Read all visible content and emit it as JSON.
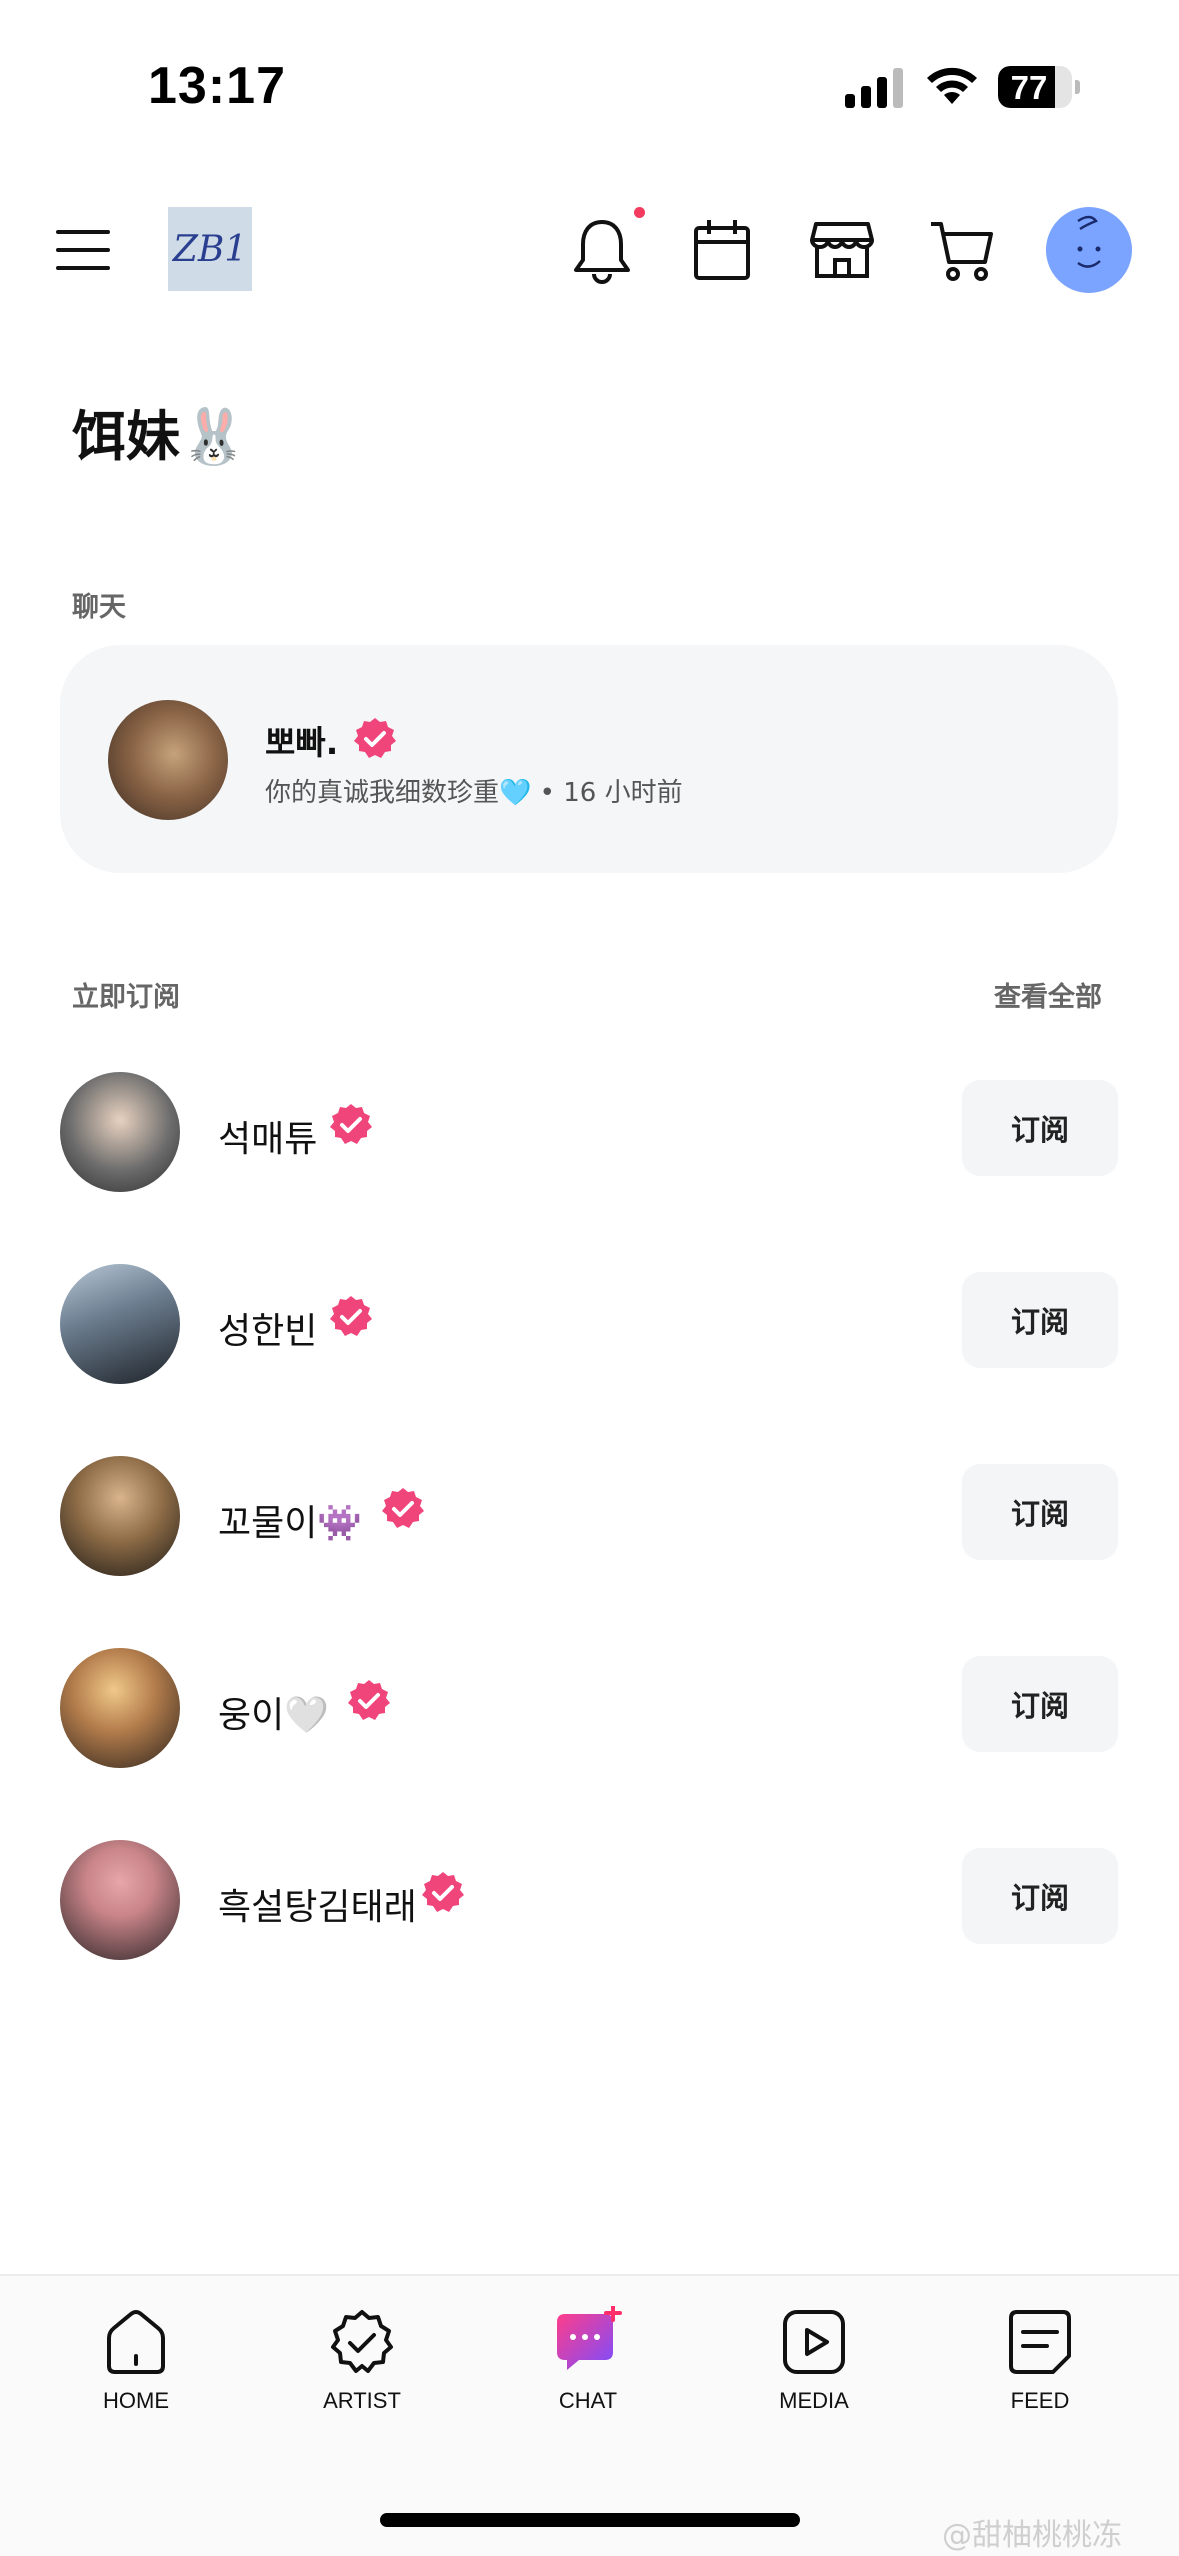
{
  "status_bar": {
    "time": "13:17",
    "battery": "77",
    "battery_level": 0.77
  },
  "header": {
    "logo_text": "ZB1",
    "icons": [
      "menu-icon",
      "bell-icon",
      "calendar-icon",
      "shop-icon",
      "cart-icon"
    ],
    "has_notification": true
  },
  "page": {
    "title": "饵妹🐰"
  },
  "chat_section": {
    "label": "聊天",
    "item": {
      "name": "뽀빠.",
      "preview": "你的真诚我细数珍重🩵 • 16 小时前"
    }
  },
  "subscribe_section": {
    "label": "立即订阅",
    "view_all": "查看全部",
    "button_label": "订阅",
    "items": [
      {
        "name": "석매튜"
      },
      {
        "name": "성한빈"
      },
      {
        "name": "꼬물이👾"
      },
      {
        "name": "웅이🤍"
      },
      {
        "name": "흑설탕김태래"
      }
    ]
  },
  "bottom_nav": {
    "items": [
      {
        "label": "HOME",
        "icon": "home-icon"
      },
      {
        "label": "ARTIST",
        "icon": "artist-badge-icon"
      },
      {
        "label": "CHAT",
        "icon": "chat-icon"
      },
      {
        "label": "MEDIA",
        "icon": "media-play-icon"
      },
      {
        "label": "FEED",
        "icon": "feed-icon"
      }
    ],
    "active": "CHAT"
  },
  "watermark": "@甜柚桃桃冻",
  "colors": {
    "verified": "#f0457a",
    "chat_gradient_start": "#ff3d8a",
    "chat_gradient_end": "#7a4dff",
    "card_bg": "#f5f6f8"
  }
}
